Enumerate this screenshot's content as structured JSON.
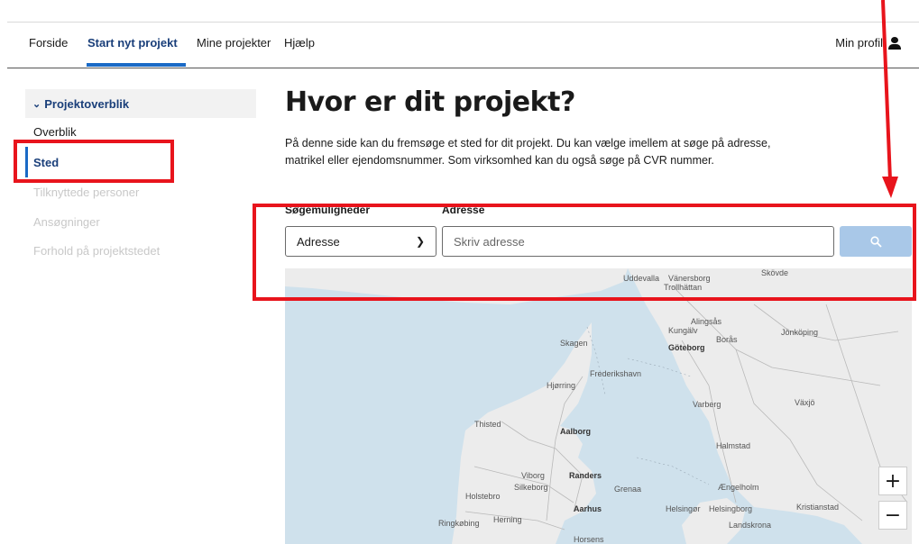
{
  "nav": {
    "items": [
      "Forside",
      "Start nyt projekt",
      "Mine projekter",
      "Hjælp"
    ],
    "active_index": 1,
    "profile_label": "Min profil"
  },
  "sidebar": {
    "section_title": "Projektoverblik",
    "items": [
      {
        "label": "Overblik",
        "state": "normal"
      },
      {
        "label": "Sted",
        "state": "current"
      },
      {
        "label": "Tilknyttede personer",
        "state": "disabled"
      },
      {
        "label": "Ansøgninger",
        "state": "disabled"
      },
      {
        "label": "Forhold på projektstedet",
        "state": "disabled"
      }
    ]
  },
  "main": {
    "title": "Hvor er dit projekt?",
    "description": "På denne side kan du fremsøge et sted for dit projekt. Du kan vælge imellem at søge på adresse, matrikel eller ejendomsnummer. Som virksomhed kan du også søge på CVR nummer.",
    "search_options_label": "Søgemuligheder",
    "address_label": "Adresse",
    "search_option_selected": "Adresse",
    "address_placeholder": "Skriv adresse"
  },
  "map": {
    "place_labels": [
      "Uddevalla",
      "Vänersborg",
      "Trollhättan",
      "Skövde",
      "Alingsås",
      "Kungälv",
      "Borås",
      "Jönköping",
      "Skagen",
      "Göteborg",
      "Frederikshavn",
      "Hjørring",
      "Varberg",
      "Växjö",
      "Thisted",
      "Aalborg",
      "Halmstad",
      "Viborg",
      "Randers",
      "Holstebro",
      "Silkeborg",
      "Grenaa",
      "Ængelholm",
      "Aarhus",
      "Helsingør",
      "Helsingborg",
      "Kristianstad",
      "Ringkøbing",
      "Herning",
      "Landskrona",
      "Horsens"
    ],
    "zoom_in": "+",
    "zoom_out": "−"
  },
  "colors": {
    "accent": "#1a6ac6",
    "nav_active": "#1a3f7a",
    "annotation": "#e8141c",
    "search_button": "#a9c8e8"
  }
}
